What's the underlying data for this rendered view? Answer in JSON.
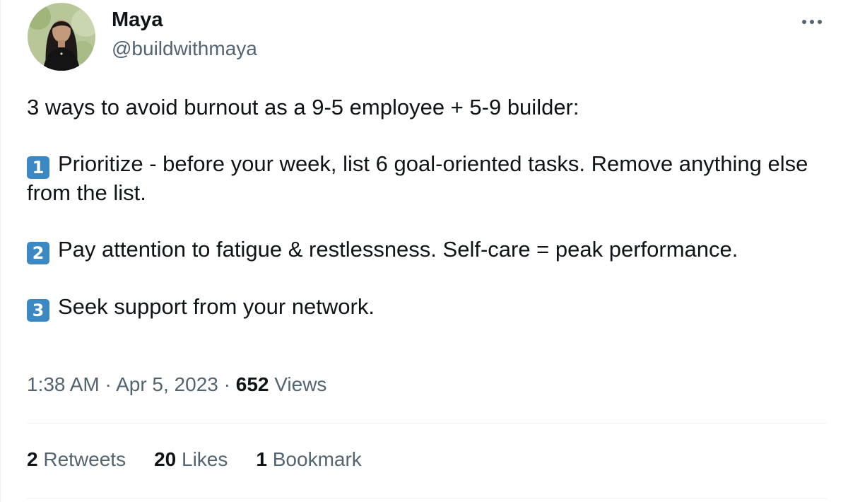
{
  "author": {
    "name": "Maya",
    "handle": "@buildwithmaya"
  },
  "tweet": {
    "intro": "3 ways to avoid burnout as a 9-5 employee + 5-9 builder:",
    "points": [
      {
        "badge": "1",
        "text": "Prioritize - before your week, list 6 goal-oriented tasks. Remove anything else from the list."
      },
      {
        "badge": "2",
        "text": "Pay attention to fatigue & restlessness. Self-care = peak performance."
      },
      {
        "badge": "3",
        "text": "Seek support from your network."
      }
    ]
  },
  "meta": {
    "time": "1:38 AM",
    "separator": "·",
    "date": "Apr 5, 2023",
    "views_count": "652",
    "views_label": "Views"
  },
  "stats": {
    "retweets_count": "2",
    "retweets_label": "Retweets",
    "likes_count": "20",
    "likes_label": "Likes",
    "bookmarks_count": "1",
    "bookmarks_label": "Bookmark"
  },
  "icons": {
    "more": "more-horizontal-icon"
  },
  "colors": {
    "text_primary": "#0f1419",
    "text_secondary": "#536471",
    "keycap_blue": "#3b88c3",
    "divider": "#eff3f4"
  }
}
